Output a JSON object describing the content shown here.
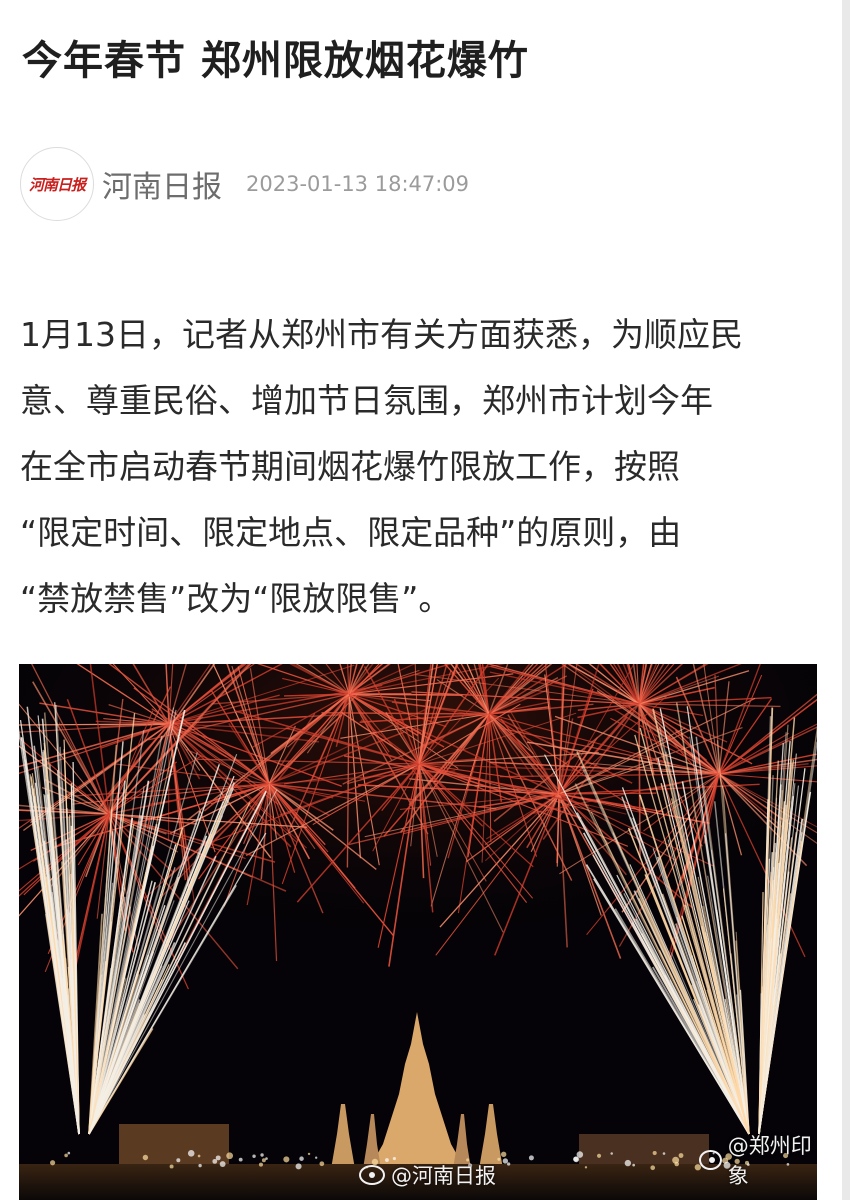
{
  "article": {
    "title": "今年春节 郑州限放烟花爆竹",
    "source_name": "河南日报",
    "source_logo_text": "河南日报",
    "timestamp": "2023-01-13 18:47:09",
    "lines": [
      "1月13日，记者从郑州市有关方面获悉，为顺应民",
      "意、尊重民俗、增加节日氛围，郑州市计划今年",
      "在全市启动春节期间烟花爆竹限放工作，按照",
      "“限定时间、限定地点、限定品种”的原则，由",
      "“禁放禁售”改为“限放限售”。"
    ]
  },
  "photo": {
    "icon": "fireworks-photo",
    "watermark_left": "@河南日报",
    "watermark_right": "@郑州印象"
  }
}
